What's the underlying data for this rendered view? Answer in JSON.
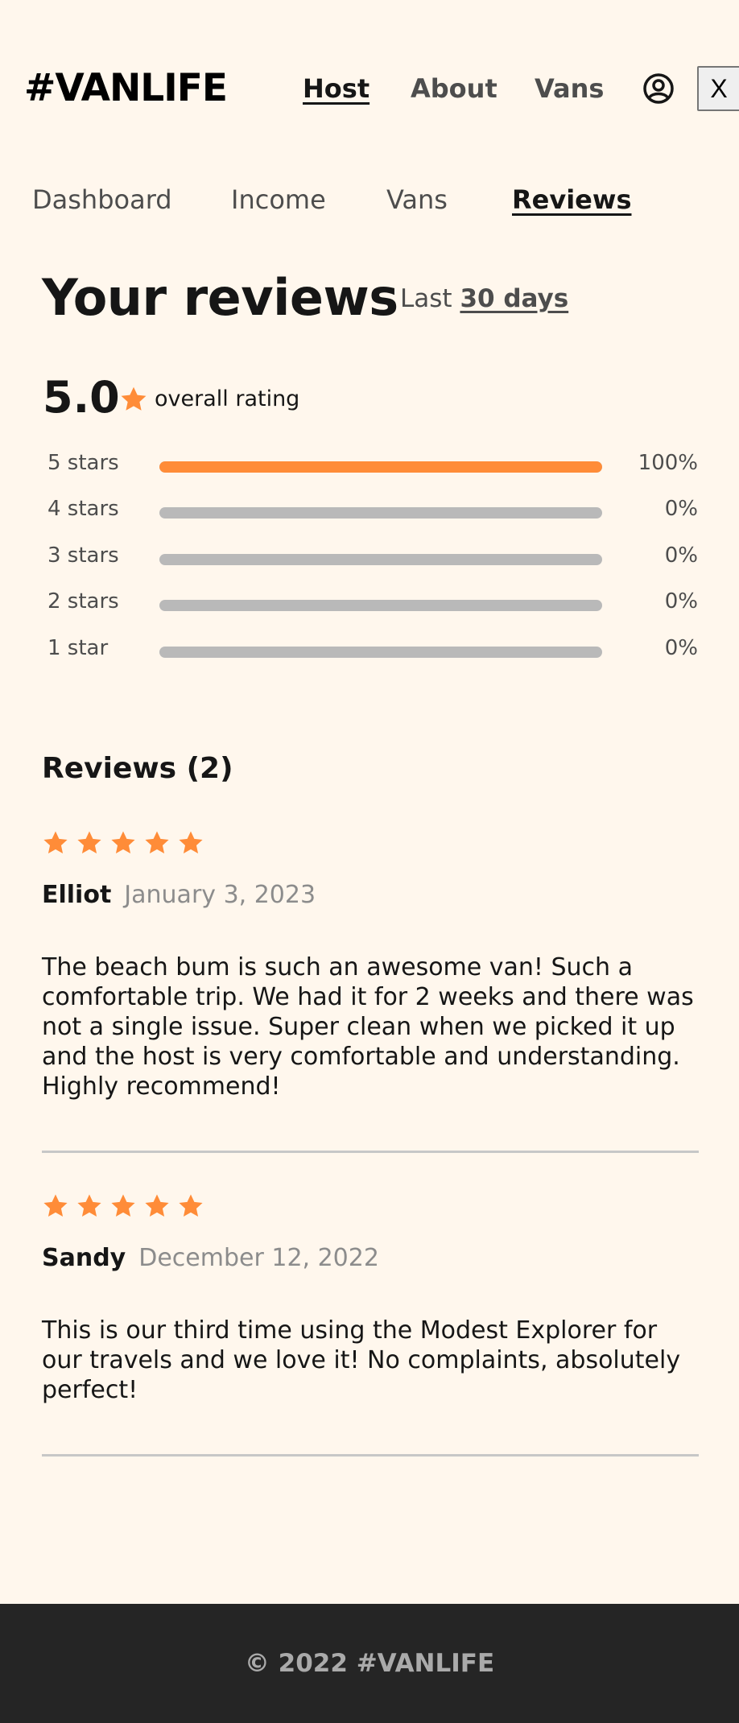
{
  "header": {
    "logo": "#VANLIFE",
    "nav": [
      {
        "label": "Host",
        "active": true
      },
      {
        "label": "About",
        "active": false
      },
      {
        "label": "Vans",
        "active": false
      }
    ],
    "user_icon": "user-circle-icon",
    "close_label": "X"
  },
  "subnav": [
    {
      "label": "Dashboard",
      "active": false
    },
    {
      "label": "Income",
      "active": false
    },
    {
      "label": "Vans",
      "active": false
    },
    {
      "label": "Reviews",
      "active": true
    }
  ],
  "page": {
    "title": "Your reviews",
    "period_prefix": "Last",
    "period_value": "30 days"
  },
  "overall": {
    "score": "5.0",
    "label": "overall rating",
    "star_icon": "star-icon"
  },
  "breakdown": [
    {
      "label": "5 stars",
      "percent": 100,
      "percent_text": "100%"
    },
    {
      "label": "4 stars",
      "percent": 0,
      "percent_text": "0%"
    },
    {
      "label": "3 stars",
      "percent": 0,
      "percent_text": "0%"
    },
    {
      "label": "2 stars",
      "percent": 0,
      "percent_text": "0%"
    },
    {
      "label": "1 star",
      "percent": 0,
      "percent_text": "0%"
    }
  ],
  "reviews": {
    "heading": "Reviews (2)",
    "items": [
      {
        "rating": 5,
        "name": "Elliot",
        "date": "January 3, 2023",
        "text": "The beach bum is such an awesome van! Such a comfortable trip. We had it for 2 weeks and there was not a single issue. Super clean when we picked it up and the host is very comfortable and understanding. Highly recommend!"
      },
      {
        "rating": 5,
        "name": "Sandy",
        "date": "December 12, 2022",
        "text": "This is our third time using the Modest Explorer for our travels and we love it! No complaints, absolutely perfect!"
      }
    ]
  },
  "footer": {
    "text": "© 2022 #VANLIFE"
  },
  "colors": {
    "background": "#FFF7ED",
    "accent": "#FF8C38",
    "footer_bg": "#252525"
  }
}
